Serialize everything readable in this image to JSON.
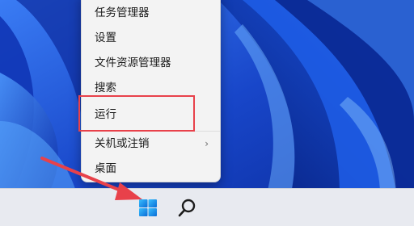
{
  "context_menu": {
    "items": [
      {
        "label": "任务管理器"
      },
      {
        "label": "设置"
      },
      {
        "label": "文件资源管理器"
      },
      {
        "label": "搜索"
      },
      {
        "label": "运行"
      },
      {
        "label": "关机或注销",
        "chevron": "›"
      },
      {
        "label": "桌面"
      }
    ]
  },
  "taskbar": {
    "start_icon": "windows-logo-icon",
    "search_icon": "search-icon"
  },
  "annotations": {
    "highlight_color": "#e8414a",
    "arrow_color": "#e8414a"
  },
  "wallpaper": {
    "colors": [
      "#1a4fd0",
      "#0b2ca8",
      "#3d7df2"
    ]
  }
}
